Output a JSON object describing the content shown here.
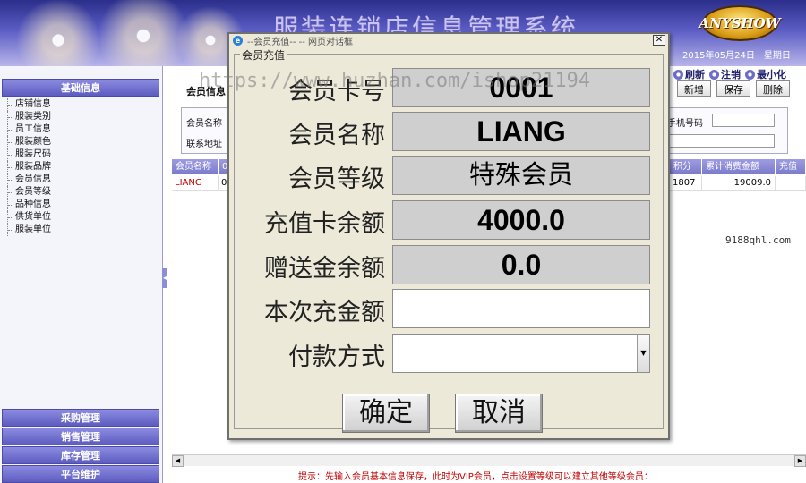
{
  "header": {
    "system_title": "服装连锁店信息管理系统",
    "logo_text": "ANYSHOW",
    "date_text": "2015年05月24日　星期日",
    "actions": [
      {
        "label": "刷新",
        "icon": "refresh-icon"
      },
      {
        "label": "注销",
        "icon": "logout-icon"
      },
      {
        "label": "最小化",
        "icon": "minimize-icon"
      }
    ]
  },
  "sidebar": {
    "section_title": "基础信息",
    "items": [
      "店铺信息",
      "服装类别",
      "员工信息",
      "服装颜色",
      "服装尺码",
      "服装品牌",
      "会员信息",
      "会员等级",
      "品种信息",
      "供货单位",
      "服装单位"
    ],
    "bottom_sections": [
      "采购管理",
      "销售管理",
      "库存管理",
      "平台维护"
    ]
  },
  "main": {
    "tab_label": "会员信息",
    "toolbar": {
      "add_label": "新增",
      "save_label": "保存",
      "delete_label": "删除"
    },
    "form": {
      "member_name_label": "会员名称",
      "address_label": "联系地址",
      "phone_label": "手机号码"
    },
    "grid": {
      "columns": [
        "会员名称",
        "00",
        "积分",
        "累计消费金额",
        "充值"
      ],
      "row": [
        "LIANG",
        "00",
        "1807",
        "19009.0",
        ""
      ]
    },
    "hint": "提示：先输入会员基本信息保存，此时为VIP会员，点击设置等级可以建立其他等级会员："
  },
  "watermarks": {
    "overlay": "https://www.huzhan.com/ishop21194",
    "side": "9188qhl.com"
  },
  "dialog": {
    "window_title": "--会员充值-- -- 网页对话框",
    "group_title": "会员充值",
    "fields": [
      {
        "label": "会员卡号",
        "value": "0001"
      },
      {
        "label": "会员名称",
        "value": "LIANG"
      },
      {
        "label": "会员等级",
        "value": "特殊会员"
      },
      {
        "label": "充值卡余额",
        "value": "4000.0"
      },
      {
        "label": "赠送金余额",
        "value": "0.0"
      },
      {
        "label": "本次充金额",
        "value": ""
      },
      {
        "label": "付款方式",
        "value": ""
      }
    ],
    "confirm_label": "确定",
    "cancel_label": "取消"
  }
}
